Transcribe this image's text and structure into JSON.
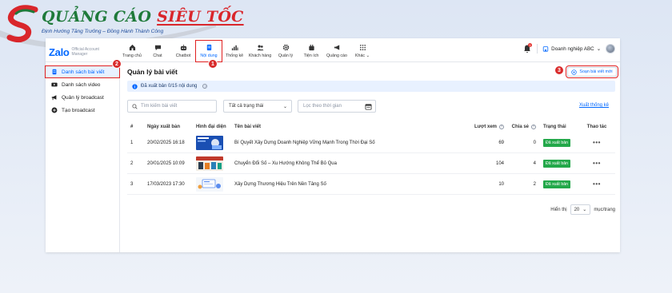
{
  "brand": {
    "name_part1": "QUẢNG CÁO",
    "name_part2": "SIÊU TỐC",
    "slogan": "Định Hướng Tăng Trưởng – Đồng Hành Thành Công"
  },
  "app": {
    "logo": "Zalo",
    "logo_sub1": "Official Account",
    "logo_sub2": "Manager"
  },
  "nav": {
    "items": [
      {
        "label": "Trang chủ",
        "icon": "home-icon"
      },
      {
        "label": "Chat",
        "icon": "chat-icon"
      },
      {
        "label": "Chatbot",
        "icon": "chatbot-icon"
      },
      {
        "label": "Nội dung",
        "icon": "content-icon"
      },
      {
        "label": "Thống kê",
        "icon": "stats-icon"
      },
      {
        "label": "Khách hàng",
        "icon": "customers-icon"
      },
      {
        "label": "Quản lý",
        "icon": "gear-icon"
      },
      {
        "label": "Tiện ích",
        "icon": "plugin-icon"
      },
      {
        "label": "Quảng cáo",
        "icon": "ads-icon"
      },
      {
        "label": "Khác",
        "icon": "grid-icon"
      }
    ],
    "notification_count": "1",
    "business_name": "Doanh nghiệp ABC"
  },
  "sidebar": {
    "items": [
      {
        "label": "Danh sách bài viết",
        "icon": "document-icon"
      },
      {
        "label": "Danh sách video",
        "icon": "video-icon"
      },
      {
        "label": "Quản lý broadcast",
        "icon": "megaphone-icon"
      },
      {
        "label": "Tạo broadcast",
        "icon": "plus-circle-icon"
      }
    ]
  },
  "main": {
    "title": "Quản lý bài viết",
    "new_post_label": "Soạn bài viết mới",
    "info": "Đã xuất bản 0/15 nội dung",
    "search_placeholder": "Tìm kiếm bài viết",
    "status_filter": "Tất cả trạng thái",
    "date_placeholder": "Lọc theo thời gian",
    "export_label": "Xuất thống kê",
    "columns": {
      "idx": "#",
      "date": "Ngày xuất bản",
      "thumb": "Hình đại diện",
      "title": "Tên bài viết",
      "views": "Lượt xem",
      "shares": "Chia sẻ",
      "status": "Trạng thái",
      "actions": "Thao tác"
    },
    "rows": [
      {
        "idx": "1",
        "date": "20/02/2025 16:18",
        "title": "Bí Quyết Xây Dựng Doanh Nghiệp Vững Mạnh Trong Thời Đại Số",
        "views": "69",
        "shares": "0",
        "status": "Đã xuất bản",
        "actions": "•••"
      },
      {
        "idx": "2",
        "date": "20/01/2025 10:09",
        "title": "Chuyển Đổi Số – Xu Hướng Không Thể Bỏ Qua",
        "views": "104",
        "shares": "4",
        "status": "Đã xuất bản",
        "actions": "•••"
      },
      {
        "idx": "3",
        "date": "17/03/2023 17:30",
        "title": "Xây Dựng Thương Hiệu Trên Nền Tảng Số",
        "views": "10",
        "shares": "2",
        "status": "Đã xuất bản",
        "actions": "•••"
      }
    ],
    "pager": {
      "prefix": "Hiển thị",
      "page_size": "20",
      "suffix": "mục/trang"
    }
  },
  "markers": [
    "1",
    "2",
    "3"
  ],
  "colors": {
    "accent": "#0068ff",
    "callout": "#e02020",
    "published": "#23a84a"
  }
}
